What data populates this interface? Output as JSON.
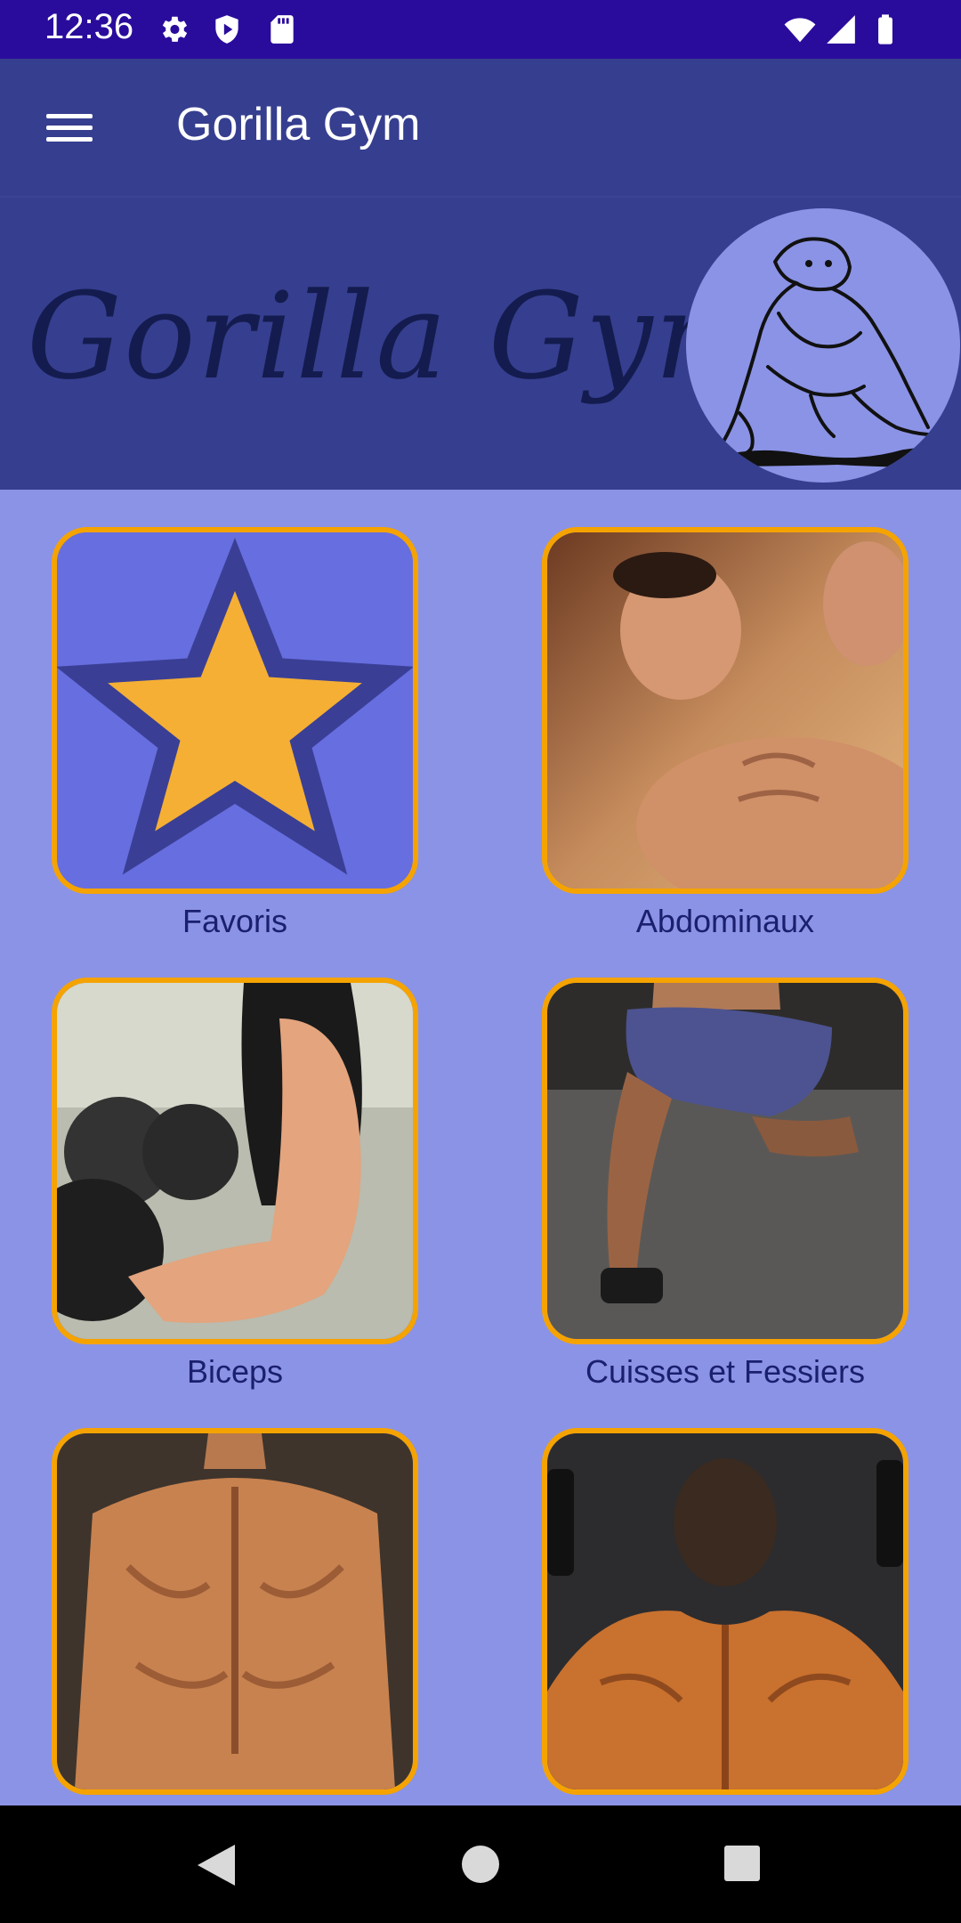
{
  "status_bar": {
    "time": "12:36",
    "icons_left": [
      "gear-icon",
      "shield-icon",
      "sd-card-icon"
    ],
    "icons_right": [
      "wifi-icon",
      "signal-icon",
      "battery-icon"
    ]
  },
  "app_bar": {
    "title": "Gorilla Gym",
    "menu_icon": "hamburger-menu-icon"
  },
  "banner": {
    "script_title": "Gorilla Gym",
    "logo": "gorilla-logo-icon"
  },
  "categories": [
    {
      "label": "Favoris",
      "image": "star-icon"
    },
    {
      "label": "Abdominaux",
      "image": "abs-photo"
    },
    {
      "label": "Biceps",
      "image": "biceps-photo"
    },
    {
      "label": "Cuisses et Fessiers",
      "image": "legs-photo"
    },
    {
      "label": "",
      "image": "back-photo"
    },
    {
      "label": "",
      "image": "shoulders-photo"
    }
  ],
  "colors": {
    "status_bar": "#2A0C9C",
    "app_bar": "#363E8F",
    "background": "#8B93E6",
    "card_border": "#F5A300",
    "label": "#1A1F6E",
    "star": "#F5AF35"
  },
  "nav_bar": {
    "buttons": [
      "back-icon",
      "home-icon",
      "recents-icon"
    ]
  }
}
